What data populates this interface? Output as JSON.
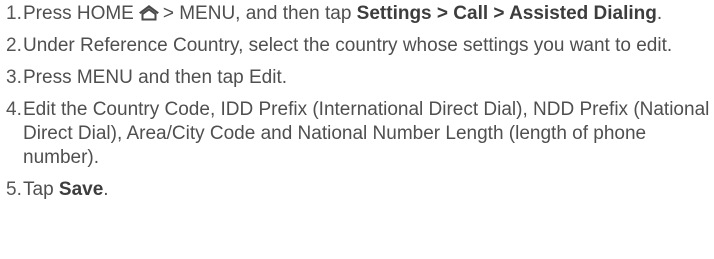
{
  "steps": [
    {
      "number": "1.",
      "before_icon": "Press HOME",
      "icon": "home-icon",
      "after_icon": "> MENU, and then tap",
      "bold1": "Settings > Call > Assisted Dialing",
      "end": "."
    },
    {
      "number": "2.",
      "text": "Under Reference Country, select the country whose settings you want to edit."
    },
    {
      "number": "3.",
      "text": "Press MENU and then tap Edit."
    },
    {
      "number": "4.",
      "text": "Edit the Country Code, IDD Prefix (International Direct Dial), NDD Prefix (National Direct Dial), Area/City Code and National Number Length (length of phone number)."
    },
    {
      "number": "5.",
      "before_bold": "Tap",
      "bold": "Save",
      "end": "."
    }
  ]
}
